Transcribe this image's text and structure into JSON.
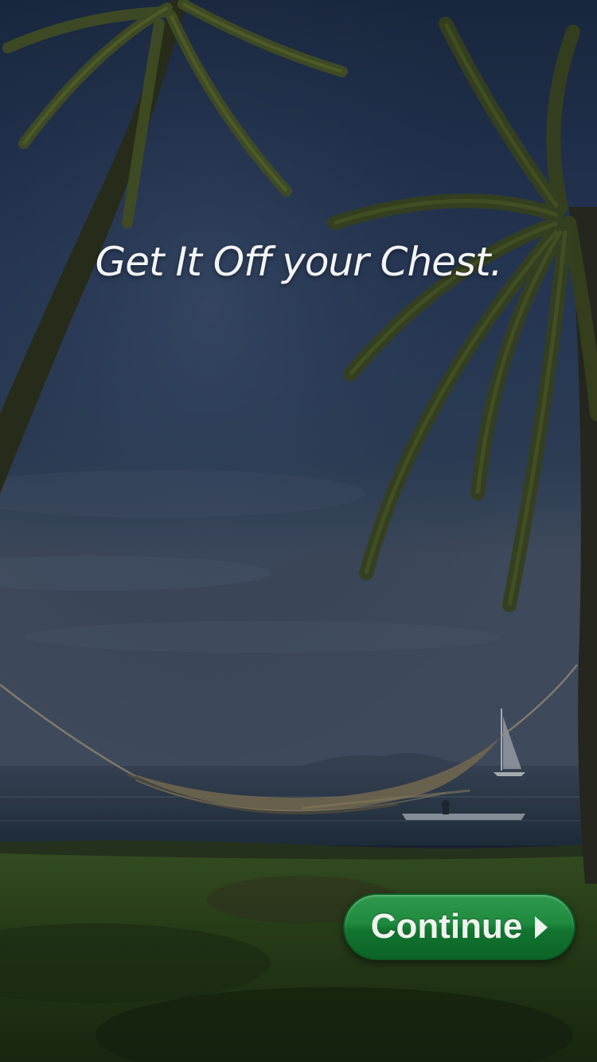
{
  "splash": {
    "tagline": "Get It Off your Chest.",
    "background_image": "tropical-beach-hammock-palm-trees",
    "continue_button": {
      "label": "Continue",
      "icon": "play-arrow-icon",
      "color": "#1a8238"
    }
  }
}
